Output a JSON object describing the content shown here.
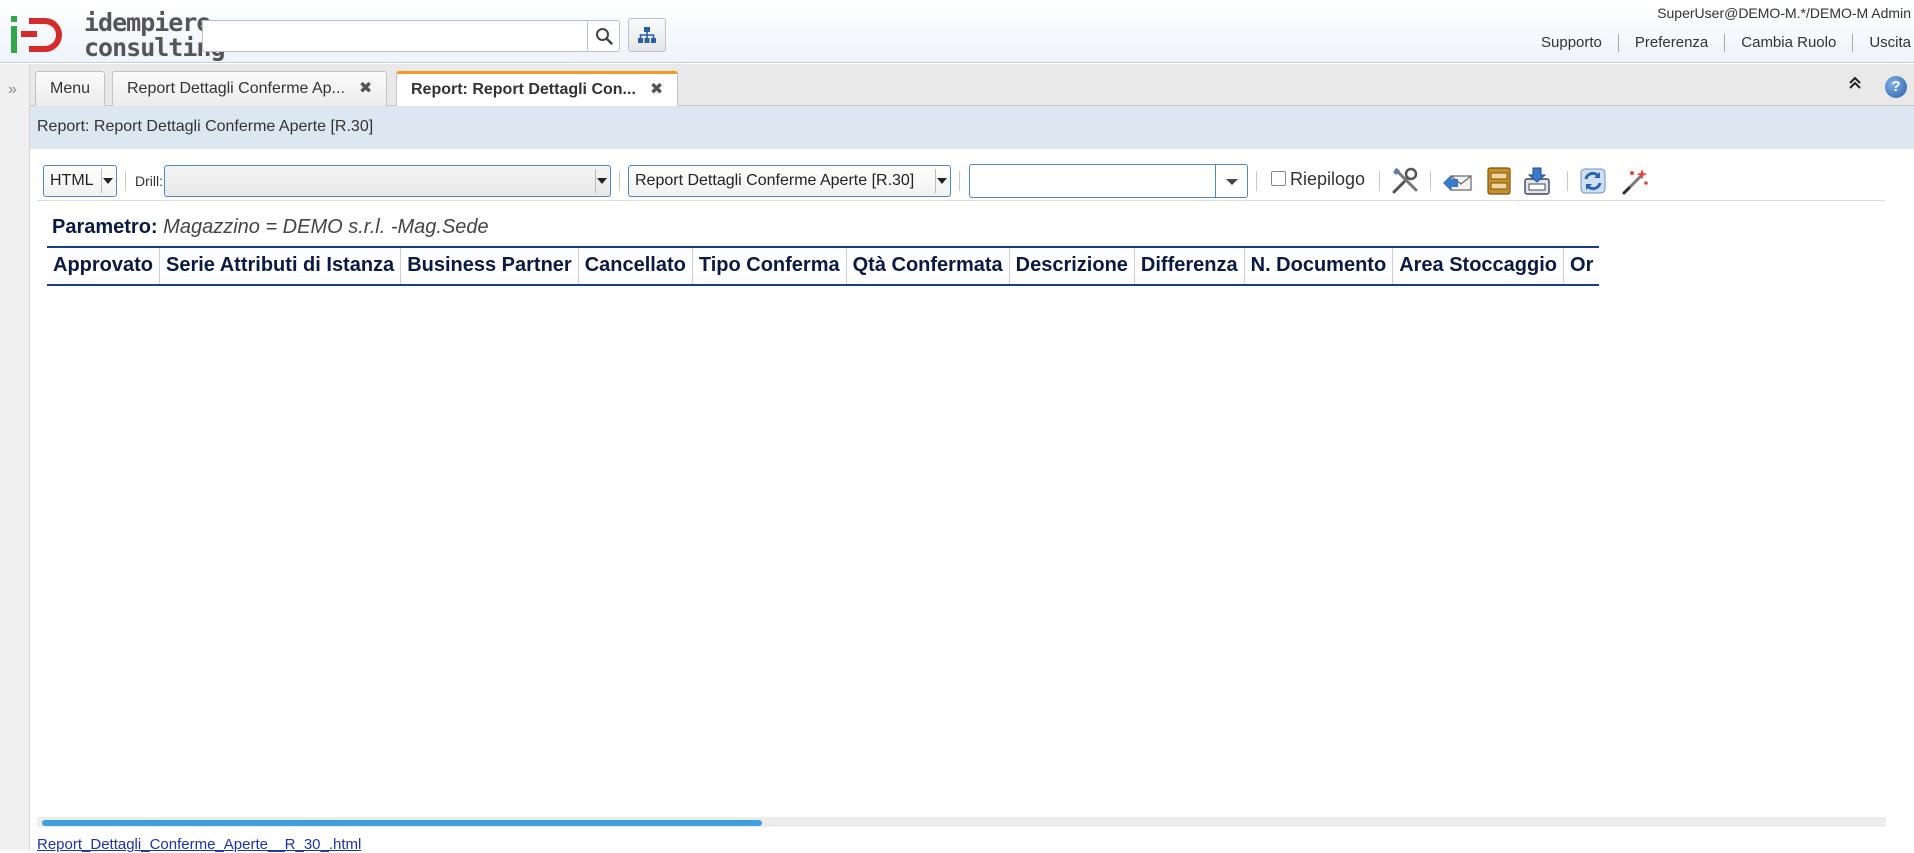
{
  "app": {
    "logo_text_line1": "idempiere",
    "logo_text_line2": "consulting",
    "search": {
      "value": "",
      "placeholder": ""
    },
    "user": "SuperUser@DEMO-M.*/DEMO-M Admin",
    "header_links": [
      "Supporto",
      "Preferenza",
      "Cambia Ruolo",
      "Uscita"
    ]
  },
  "tabs": [
    {
      "label": "Menu",
      "active": false,
      "closable": false
    },
    {
      "label": "Report Dettagli Conferme Ap...",
      "active": false,
      "closable": true
    },
    {
      "label": "Report: Report Dettagli Con...",
      "active": true,
      "closable": true
    }
  ],
  "title_strip": "Report: Report Dettagli Conferme Aperte [R.30]",
  "toolbar": {
    "format_value": "HTML",
    "drill_label": "Drill:",
    "drill_value": "",
    "report_value": "Report Dettagli Conferme Aperte [R.30]",
    "print_format_value": "",
    "summary_label": "Riepilogo",
    "summary_checked": false,
    "icons": [
      "customize-icon",
      "send-mail-icon",
      "archive-icon",
      "export-icon",
      "refresh-icon",
      "wizard-icon"
    ]
  },
  "report": {
    "param_key": "Parametro:",
    "param_value": "Magazzino = DEMO s.r.l. -Mag.Sede",
    "columns": [
      "Approvato",
      "Serie Attributi di Istanza",
      "Business Partner",
      "Cancellato",
      "Tipo Conferma",
      "Qtà Confermata",
      "Descrizione",
      "Differenza",
      "N. Documento",
      "Area Stoccaggio",
      "Or"
    ],
    "rows": []
  },
  "scroll": {
    "horizontal_fraction_visible": 0.39
  },
  "bottom_link": "Report_Dettagli_Conferme_Aperte__R_30_.html",
  "colors": {
    "accent_tab": "#f29a1e",
    "title_strip": "#dde7f1",
    "table_header_text": "#0a1a45",
    "link": "#1a33b0",
    "scroll_thumb": "#3ea0e0"
  }
}
